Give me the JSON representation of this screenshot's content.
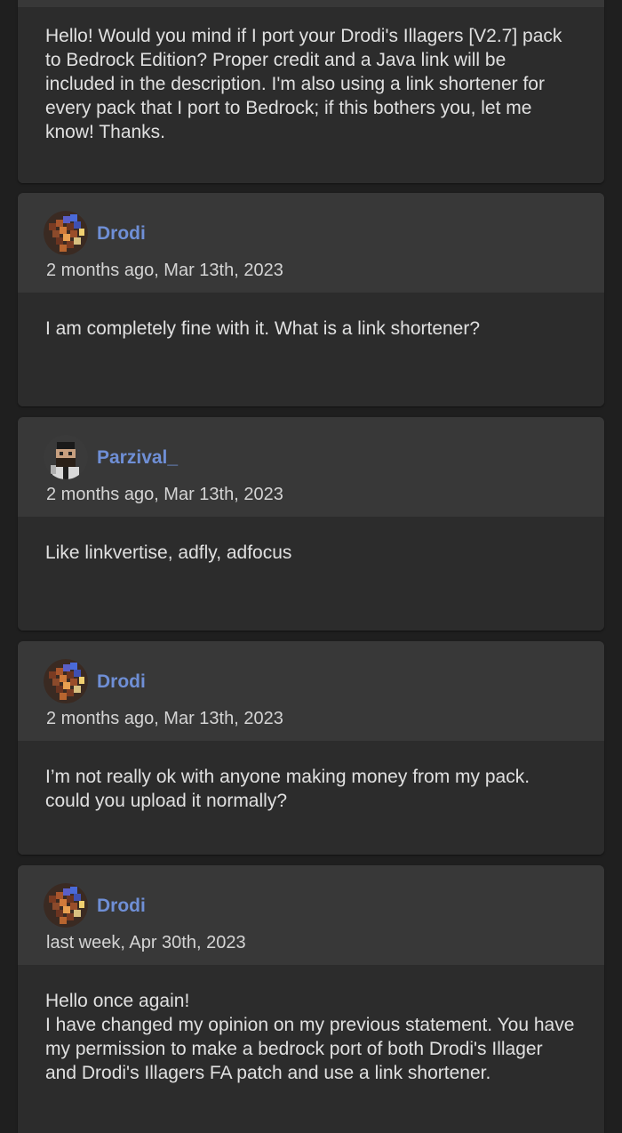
{
  "comments": [
    {
      "text": "Hello! Would you mind if I port your Drodi's Illagers [V2.7] pack to Bedrock Edition? Proper credit and a Java link will be included in the description. I'm also using a link shortener for every pack that I port to Bedrock; if this bothers you, let me know! Thanks."
    },
    {
      "author": "Drodi",
      "avatar_icon": "drodi-avatar-icon",
      "timestamp": "2 months ago, Mar 13th, 2023",
      "text": "I am completely fine with it. What is a link shortener?"
    },
    {
      "author": "Parzival_",
      "avatar_icon": "parzival-avatar-icon",
      "timestamp": "2 months ago, Mar 13th, 2023",
      "text": "Like linkvertise, adfly, adfocus"
    },
    {
      "author": "Drodi",
      "avatar_icon": "drodi-avatar-icon",
      "timestamp": "2 months ago, Mar 13th, 2023",
      "text": "I’m not really ok with anyone making money from my pack. could you upload it normally?"
    },
    {
      "author": "Drodi",
      "avatar_icon": "drodi-avatar-icon",
      "timestamp": "last week, Apr 30th, 2023",
      "text": "Hello once again!\nI have changed my opinion on my previous statement. You have my permission to make a bedrock port of both Drodi's Illager and Drodi's Illagers FA patch and use a link shortener."
    }
  ],
  "colors": {
    "background": "#1f1f1f",
    "card_header": "#383838",
    "card_body": "#2c2c2c",
    "author_link": "#6f8fd6",
    "text": "#e0e0e0"
  }
}
